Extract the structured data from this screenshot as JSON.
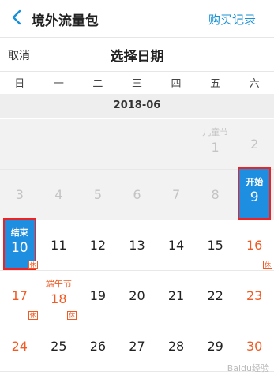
{
  "nav": {
    "title": "境外流量包",
    "action": "购买记录"
  },
  "picker": {
    "cancel": "取消",
    "title": "选择日期"
  },
  "weekdays": [
    "日",
    "一",
    "二",
    "三",
    "四",
    "五",
    "六"
  ],
  "month": "2018-06",
  "rows": [
    [
      null,
      null,
      null,
      null,
      null,
      {
        "n": "1",
        "state": "past",
        "holiday": "儿童节"
      },
      {
        "n": "2",
        "state": "past"
      }
    ],
    [
      {
        "n": "3",
        "state": "past"
      },
      {
        "n": "4",
        "state": "past"
      },
      {
        "n": "5",
        "state": "past"
      },
      {
        "n": "6",
        "state": "past"
      },
      {
        "n": "7",
        "state": "past"
      },
      {
        "n": "8",
        "state": "past"
      },
      {
        "n": "9",
        "state": "start",
        "tag": "开始"
      }
    ],
    [
      {
        "n": "10",
        "state": "end",
        "tag": "结束",
        "rest": "休"
      },
      {
        "n": "11"
      },
      {
        "n": "12"
      },
      {
        "n": "13"
      },
      {
        "n": "14"
      },
      {
        "n": "15"
      },
      {
        "n": "16",
        "state": "weekend",
        "rest": "休"
      }
    ],
    [
      {
        "n": "17",
        "state": "weekend",
        "rest": "休"
      },
      {
        "n": "18",
        "state": "weekend",
        "holiday": "端午节",
        "rest": "休"
      },
      {
        "n": "19"
      },
      {
        "n": "20"
      },
      {
        "n": "21"
      },
      {
        "n": "22"
      },
      {
        "n": "23",
        "state": "weekend"
      }
    ],
    [
      {
        "n": "24",
        "state": "weekend"
      },
      {
        "n": "25"
      },
      {
        "n": "26"
      },
      {
        "n": "27"
      },
      {
        "n": "28"
      },
      {
        "n": "29"
      },
      {
        "n": "30",
        "state": "weekend"
      }
    ]
  ],
  "watermark": "Baidu经验",
  "colors": {
    "accent": "#1890d6",
    "selected": "#1e8ee0",
    "highlight_border": "#ee2222",
    "weekend": "#f15a22"
  }
}
